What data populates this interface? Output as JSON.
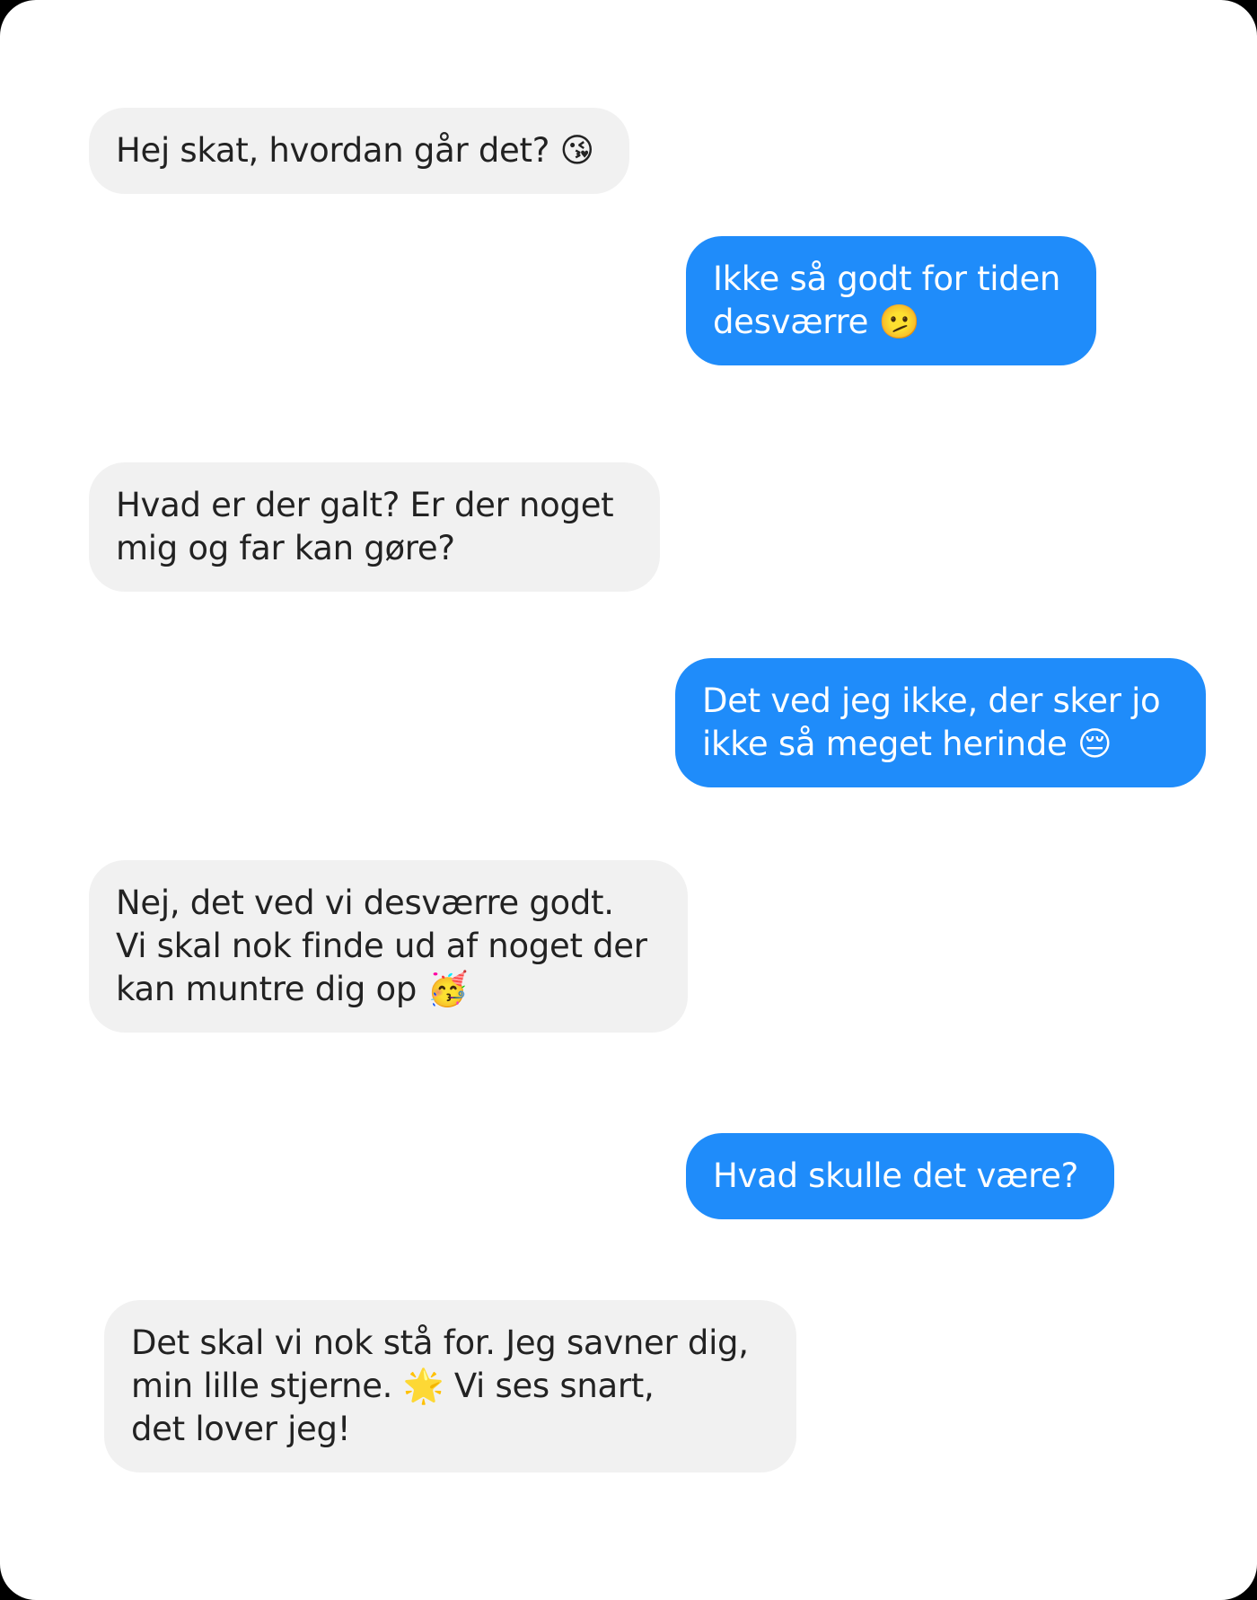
{
  "colors": {
    "received_bubble": "#f1f1f1",
    "sent_bubble": "#1f8cfa",
    "received_text": "#222222",
    "sent_text": "#ffffff"
  },
  "messages": [
    {
      "direction": "received",
      "text": "Hej skat, hvordan går det? 😘"
    },
    {
      "direction": "sent",
      "text": "Ikke så godt for tiden\ndesværre 🫤"
    },
    {
      "direction": "received",
      "text": "Hvad er der galt? Er der noget\nmig og far kan gøre?"
    },
    {
      "direction": "sent",
      "text": "Det ved jeg ikke, der sker jo\nikke så meget herinde 😔"
    },
    {
      "direction": "received",
      "text": "Nej, det ved vi desværre godt.\nVi skal nok finde ud af noget der\nkan muntre dig op 🥳"
    },
    {
      "direction": "sent",
      "text": "Hvad skulle det være?"
    },
    {
      "direction": "received",
      "text": "Det skal vi nok stå for. Jeg savner dig,\nmin lille stjerne. 🌟 Vi ses snart,\ndet lover jeg!"
    }
  ]
}
